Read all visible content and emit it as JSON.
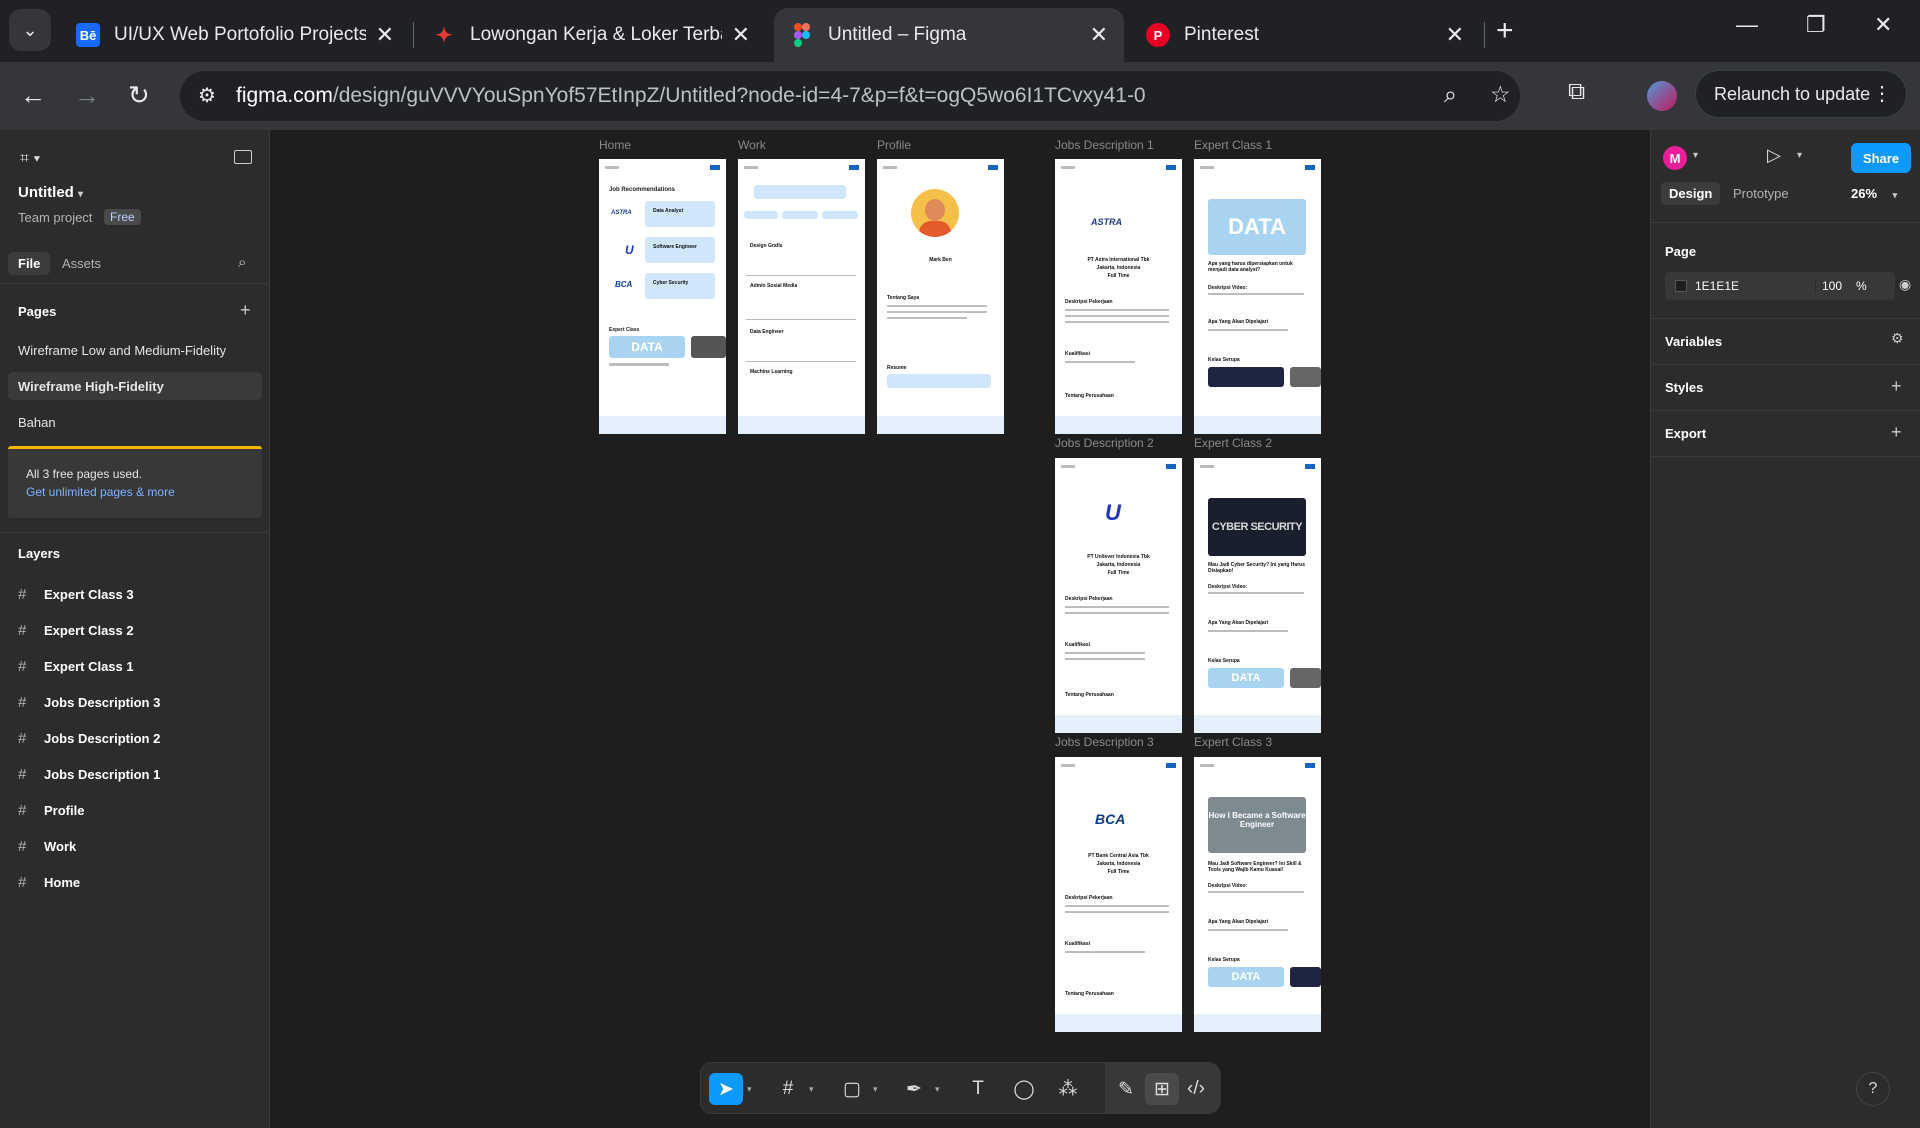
{
  "browser": {
    "tabs": [
      {
        "title": "UI/UX Web Portofolio Projects :",
        "favicon": "Bē",
        "color": "#1769ff"
      },
      {
        "title": "Lowongan Kerja & Loker Terbar",
        "favicon": "✦",
        "color": "#e53935"
      },
      {
        "title": "Untitled – Figma",
        "favicon": "◆",
        "color": "#a259ff"
      },
      {
        "title": "Pinterest",
        "favicon": "P",
        "color": "#e60023"
      }
    ],
    "url_host": "figma.com",
    "url_path": "/design/guVVVYouSpnYof57EtInpZ/Untitled?node-id=4-7&p=f&t=ogQ5wo6I1TCvxy41-0",
    "relaunch_label": "Relaunch to update"
  },
  "left_panel": {
    "file_title": "Untitled",
    "team": "Team project",
    "plan_badge": "Free",
    "tabs": {
      "file": "File",
      "assets": "Assets"
    },
    "pages_heading": "Pages",
    "pages": [
      "Wireframe Low and Medium-Fidelity",
      "Wireframe High-Fidelity",
      "Bahan"
    ],
    "upsell_line1": "All 3 free pages used.",
    "upsell_line2": "Get unlimited pages & more",
    "layers_heading": "Layers",
    "layers": [
      "Expert Class 3",
      "Expert Class 2",
      "Expert Class 1",
      "Jobs Description 3",
      "Jobs Description 2",
      "Jobs Description 1",
      "Profile",
      "Work",
      "Home"
    ]
  },
  "right_panel": {
    "avatar_initial": "M",
    "share_label": "Share",
    "tabs": {
      "design": "Design",
      "prototype": "Prototype"
    },
    "zoom": "26%",
    "page_heading": "Page",
    "page_fill_hex": "1E1E1E",
    "page_fill_opacity": "100",
    "page_fill_unit": "%",
    "variables": "Variables",
    "styles": "Styles",
    "export": "Export"
  },
  "canvas": {
    "frames": {
      "home": "Home",
      "work": "Work",
      "profile": "Profile",
      "jd1": "Jobs Description 1",
      "ec1": "Expert Class 1",
      "jd2": "Jobs Description 2",
      "ec2": "Expert Class 2",
      "jd3": "Jobs Description 3",
      "ec3": "Expert Class 3"
    },
    "home_heading": "Job Recommendations",
    "home_jobs": [
      {
        "title": "Data Analyst",
        "company": "PT Astra International Tbk"
      },
      {
        "title": "Software Engineer",
        "company": "PT Unilever Indonesia Tbk"
      },
      {
        "title": "Cyber Security",
        "company": "PT Bank Central Asia Tbk"
      }
    ],
    "home_expert": "Expert Class",
    "work_jobs": [
      "Design Grafis",
      "Admin Sosial Media",
      "Data Engineer",
      "Machine Learning"
    ],
    "profile_name": "Mark Ben",
    "profile_section": "Tentang Saya",
    "profile_resume": "Resume",
    "jd_companies": [
      "PT Astra International Tbk",
      "PT Unilever Indonesia Tbk",
      "PT Bank Central Asia Tbk"
    ],
    "jd_location": "Jakarta, Indonesia",
    "jd_type": "Full Time",
    "jd_sections": [
      "Deskripsi Pekerjaan",
      "Kualifikasi",
      "Tentang Perusahaan"
    ],
    "ec_titles": [
      "Apa yang harus dipersiapkan untuk menjadi data analyst?",
      "Mau Jadi Cyber Security? Ini yang Harus Disiapkan!",
      "Mau Jadi Software Engineer? Ini Skill & Tools yang Wajib Kamu Kuasai!"
    ],
    "ec_sections": [
      "Deskripsi Video:",
      "Apa Yang Akan Dipelajari",
      "Kelas Serupa"
    ],
    "thumb_data": "DATA",
    "thumb_cyber": "CYBER SECURITY",
    "thumb_swe": "How I Became a Software Engineer",
    "logo_astra": "ASTRA",
    "logo_unilever": "U",
    "logo_bca": "BCA"
  },
  "toolbar": {
    "tools": [
      "move-icon",
      "frame-icon",
      "rectangle-icon",
      "pen-icon",
      "text-icon",
      "comment-icon",
      "actions-icon",
      "draw-icon",
      "design-mode-icon",
      "dev-mode-icon"
    ]
  },
  "help_label": "?"
}
